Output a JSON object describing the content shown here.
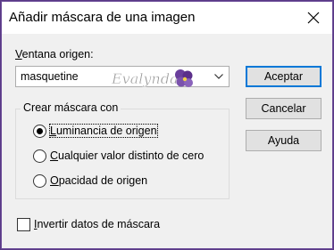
{
  "dialog": {
    "title": "Añadir máscara de una imagen"
  },
  "source_window": {
    "label_mnemonic": "V",
    "label_rest": "entana origen:",
    "selected_value": "masquetine",
    "watermark_text": "Evalynda"
  },
  "buttons": {
    "ok_label": "Aceptar",
    "cancel_label": "Cancelar",
    "help_label": "Ayuda"
  },
  "mask_group": {
    "title": "Crear máscara con",
    "options": [
      {
        "mnemonic": "L",
        "rest": "uminancia de origen",
        "selected": true
      },
      {
        "mnemonic": "C",
        "rest": "ualquier valor distinto de cero",
        "selected": false
      },
      {
        "mnemonic": "O",
        "rest": "pacidad de origen",
        "selected": false
      }
    ]
  },
  "invert": {
    "mnemonic": "I",
    "rest": "nvertir datos de máscara",
    "checked": false
  },
  "colors": {
    "accent": "#0078d7",
    "frame": "#5a3a86"
  }
}
